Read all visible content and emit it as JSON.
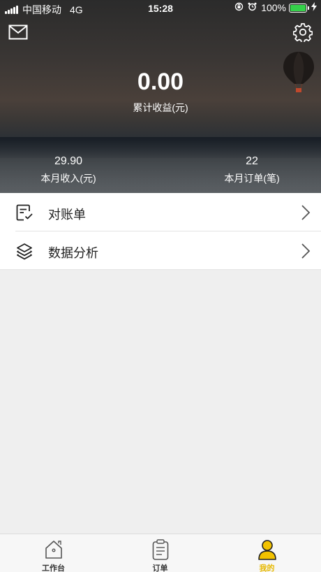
{
  "status_bar": {
    "carrier": "中国移动",
    "network": "4G",
    "time": "15:28",
    "battery": "100%",
    "icons": [
      "signal-icon",
      "rotation-lock-icon",
      "alarm-icon",
      "battery-icon",
      "charging-icon"
    ]
  },
  "header": {
    "total_earnings_value": "0.00",
    "total_earnings_label": "累计收益(元)",
    "monthly_income_value": "29.90",
    "monthly_income_label": "本月收入(元)",
    "monthly_orders_value": "22",
    "monthly_orders_label": "本月订单(笔)"
  },
  "menu": {
    "items": [
      {
        "label": "对账单",
        "icon": "statement-icon"
      },
      {
        "label": "数据分析",
        "icon": "layers-icon"
      }
    ]
  },
  "tabbar": {
    "tabs": [
      {
        "label": "工作台",
        "icon": "house-icon",
        "active": false
      },
      {
        "label": "订单",
        "icon": "clipboard-icon",
        "active": false
      },
      {
        "label": "我的",
        "icon": "person-icon",
        "active": true
      }
    ]
  },
  "colors": {
    "accent": "#e6b800",
    "battery": "#35d14a"
  }
}
